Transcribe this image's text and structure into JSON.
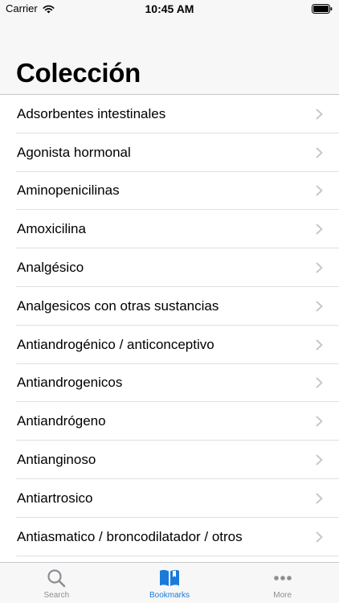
{
  "status_bar": {
    "carrier": "Carrier",
    "time": "10:45 AM"
  },
  "header": {
    "title": "Colección"
  },
  "list": {
    "items": [
      {
        "label": "Adsorbentes intestinales"
      },
      {
        "label": "Agonista hormonal"
      },
      {
        "label": "Aminopenicilinas"
      },
      {
        "label": "Amoxicilina"
      },
      {
        "label": "Analgésico"
      },
      {
        "label": "Analgesicos con otras sustancias"
      },
      {
        "label": "Antiandrogénico / anticonceptivo"
      },
      {
        "label": "Antiandrogenicos"
      },
      {
        "label": "Antiandrógeno"
      },
      {
        "label": "Antianginoso"
      },
      {
        "label": "Antiartrosico"
      },
      {
        "label": "Antiasmatico / broncodilatador / otros"
      }
    ]
  },
  "tab_bar": {
    "tabs": [
      {
        "label": "Search",
        "icon": "search-icon",
        "active": false
      },
      {
        "label": "Bookmarks",
        "icon": "bookmarks-icon",
        "active": true
      },
      {
        "label": "More",
        "icon": "more-icon",
        "active": false
      }
    ]
  },
  "colors": {
    "accent": "#1a7ad9",
    "inactive": "#8e8e93",
    "chevron": "#c7c7cc",
    "bar_background": "#f7f7f7"
  }
}
